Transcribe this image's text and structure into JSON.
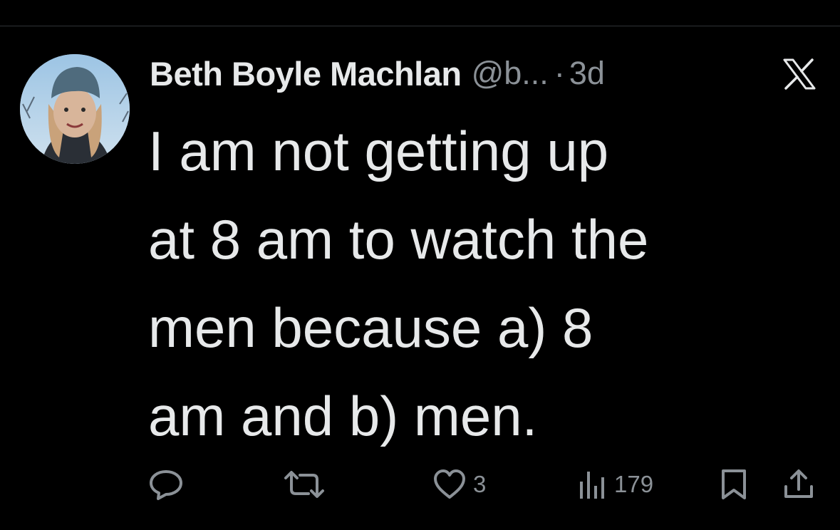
{
  "tweet": {
    "display_name": "Beth Boyle Machlan",
    "handle": "@b...",
    "separator": "·",
    "time": "3d",
    "text": "I am not getting up\nat 8 am to watch the\nmen because a) 8\nam and b) men."
  },
  "actions": {
    "reply_icon": "reply-icon",
    "retweet_icon": "retweet-icon",
    "like_icon": "heart-icon",
    "like_count": "3",
    "views_icon": "views-icon",
    "views_count": "179",
    "bookmark_icon": "bookmark-icon",
    "share_icon": "share-icon"
  },
  "colors": {
    "background": "#000000",
    "primary_text": "#e7e9ea",
    "secondary_text": "#8b9197"
  }
}
